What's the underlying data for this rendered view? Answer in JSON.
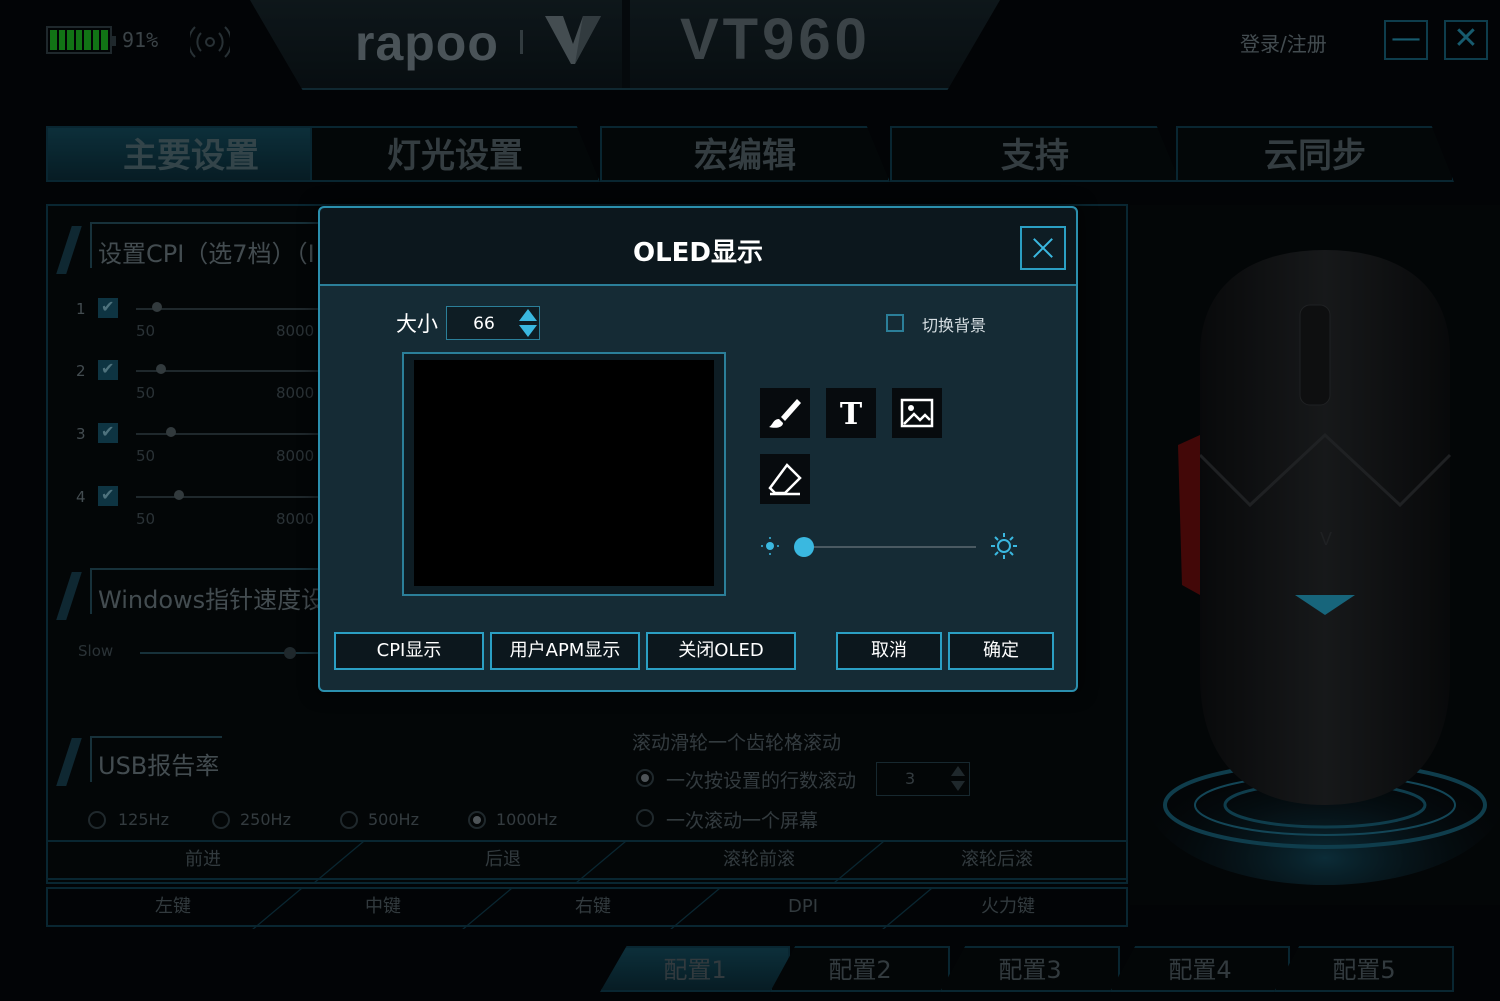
{
  "titlebar": {
    "battery_pct": "91%",
    "brand": "rapoo",
    "model": "VT960",
    "login": "登录/注册",
    "minimize": "—",
    "close": "✕"
  },
  "main_tabs": [
    "主要设置",
    "灯光设置",
    "宏编辑",
    "支持",
    "云同步"
  ],
  "cpi": {
    "heading": "设置CPI（选7档）（I",
    "rows": [
      {
        "idx": "1",
        "min": "50",
        "max": "8000"
      },
      {
        "idx": "2",
        "min": "50",
        "max": "8000"
      },
      {
        "idx": "3",
        "min": "50",
        "max": "8000"
      },
      {
        "idx": "4",
        "min": "50",
        "max": "8000"
      }
    ]
  },
  "pointer": {
    "heading": "Windows指针速度设置",
    "slow": "Slow"
  },
  "usb": {
    "heading": "USB报告率",
    "options": [
      "125Hz",
      "250Hz",
      "500Hz",
      "1000Hz"
    ],
    "selected": "1000Hz"
  },
  "scroll": {
    "heading": "滚动滑轮一个齿轮格滚动",
    "option1": "一次按设置的行数滚动",
    "lines_value": "3",
    "option2": "一次滚动一个屏幕"
  },
  "button_row1": [
    "前进",
    "后退",
    "滚轮前滚",
    "滚轮后滚"
  ],
  "button_row2": [
    "左键",
    "中键",
    "右键",
    "DPI",
    "火力键"
  ],
  "profiles": [
    "配置1",
    "配置2",
    "配置3",
    "配置4",
    "配置5"
  ],
  "modal": {
    "title": "OLED显示",
    "size_label": "大小",
    "size_value": "66",
    "bg_toggle": "切换背景",
    "tools": [
      "brush-icon",
      "text-icon",
      "image-icon",
      "eraser-icon"
    ],
    "brightness_level": 0,
    "buttons": {
      "cpi": "CPI显示",
      "apm": "用户APM显示",
      "off": "关闭OLED",
      "cancel": "取消",
      "ok": "确定"
    }
  },
  "colors": {
    "accent": "#3ab8e0",
    "border": "#12465a",
    "battery": "#1fd327"
  }
}
